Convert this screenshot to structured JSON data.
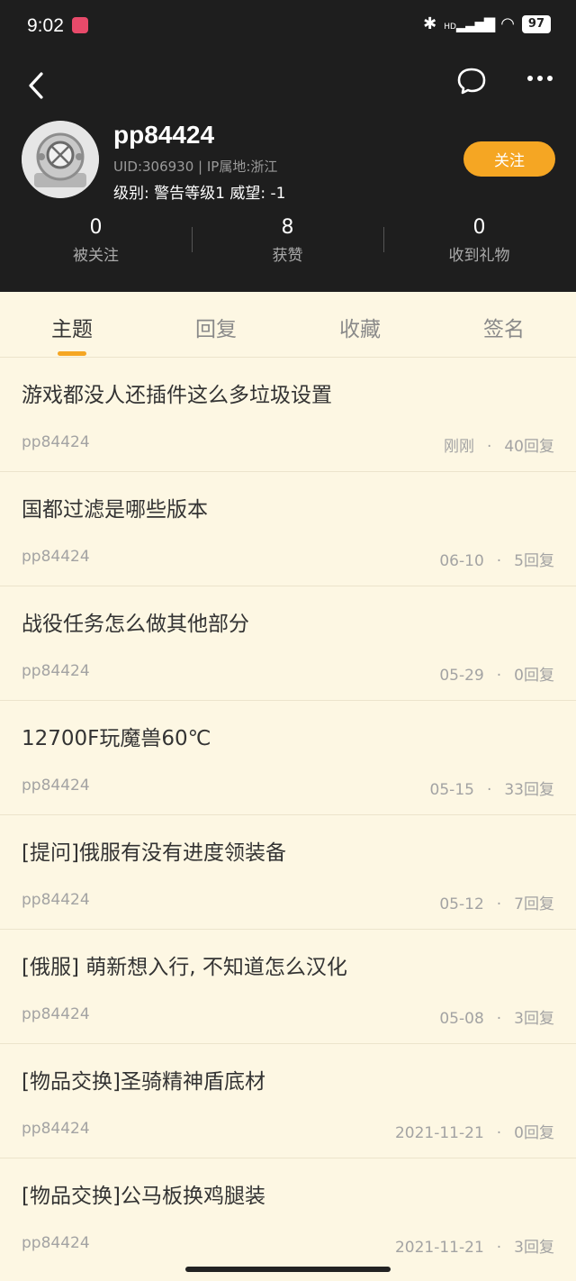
{
  "status_bar": {
    "time": "9:02",
    "battery": "97",
    "network": "HD"
  },
  "profile": {
    "username": "pp84424",
    "uid_line": "UID:306930 | IP属地:浙江",
    "level_line": "级别: 警告等级1 威望: -1",
    "follow_label": "关注"
  },
  "stats": [
    {
      "value": "0",
      "label": "被关注"
    },
    {
      "value": "8",
      "label": "获赞"
    },
    {
      "value": "0",
      "label": "收到礼物"
    }
  ],
  "tabs": [
    "主题",
    "回复",
    "收藏",
    "签名"
  ],
  "active_tab": "主题",
  "posts": [
    {
      "title": "游戏都没人还插件这么多垃圾设置",
      "author": "pp84424",
      "time": "刚刚",
      "replies": "40回复"
    },
    {
      "title": "国都过滤是哪些版本",
      "author": "pp84424",
      "time": "06-10",
      "replies": "5回复"
    },
    {
      "title": "战役任务怎么做其他部分",
      "author": "pp84424",
      "time": "05-29",
      "replies": "0回复"
    },
    {
      "title": "12700F玩魔兽60℃",
      "author": "pp84424",
      "time": "05-15",
      "replies": "33回复"
    },
    {
      "title": "[提问]俄服有没有进度领装备",
      "author": "pp84424",
      "time": "05-12",
      "replies": "7回复"
    },
    {
      "title": "[俄服] 萌新想入行, 不知道怎么汉化",
      "author": "pp84424",
      "time": "05-08",
      "replies": "3回复"
    },
    {
      "title": "[物品交换]圣骑精神盾底材",
      "author": "pp84424",
      "time": "2021-11-21",
      "replies": "0回复"
    },
    {
      "title": "[物品交换]公马板换鸡腿装",
      "author": "pp84424",
      "time": "2021-11-21",
      "replies": "3回复"
    }
  ],
  "colors": {
    "header_bg": "#1e1e1e",
    "page_bg": "#fdf7e3",
    "accent": "#f5a623"
  }
}
